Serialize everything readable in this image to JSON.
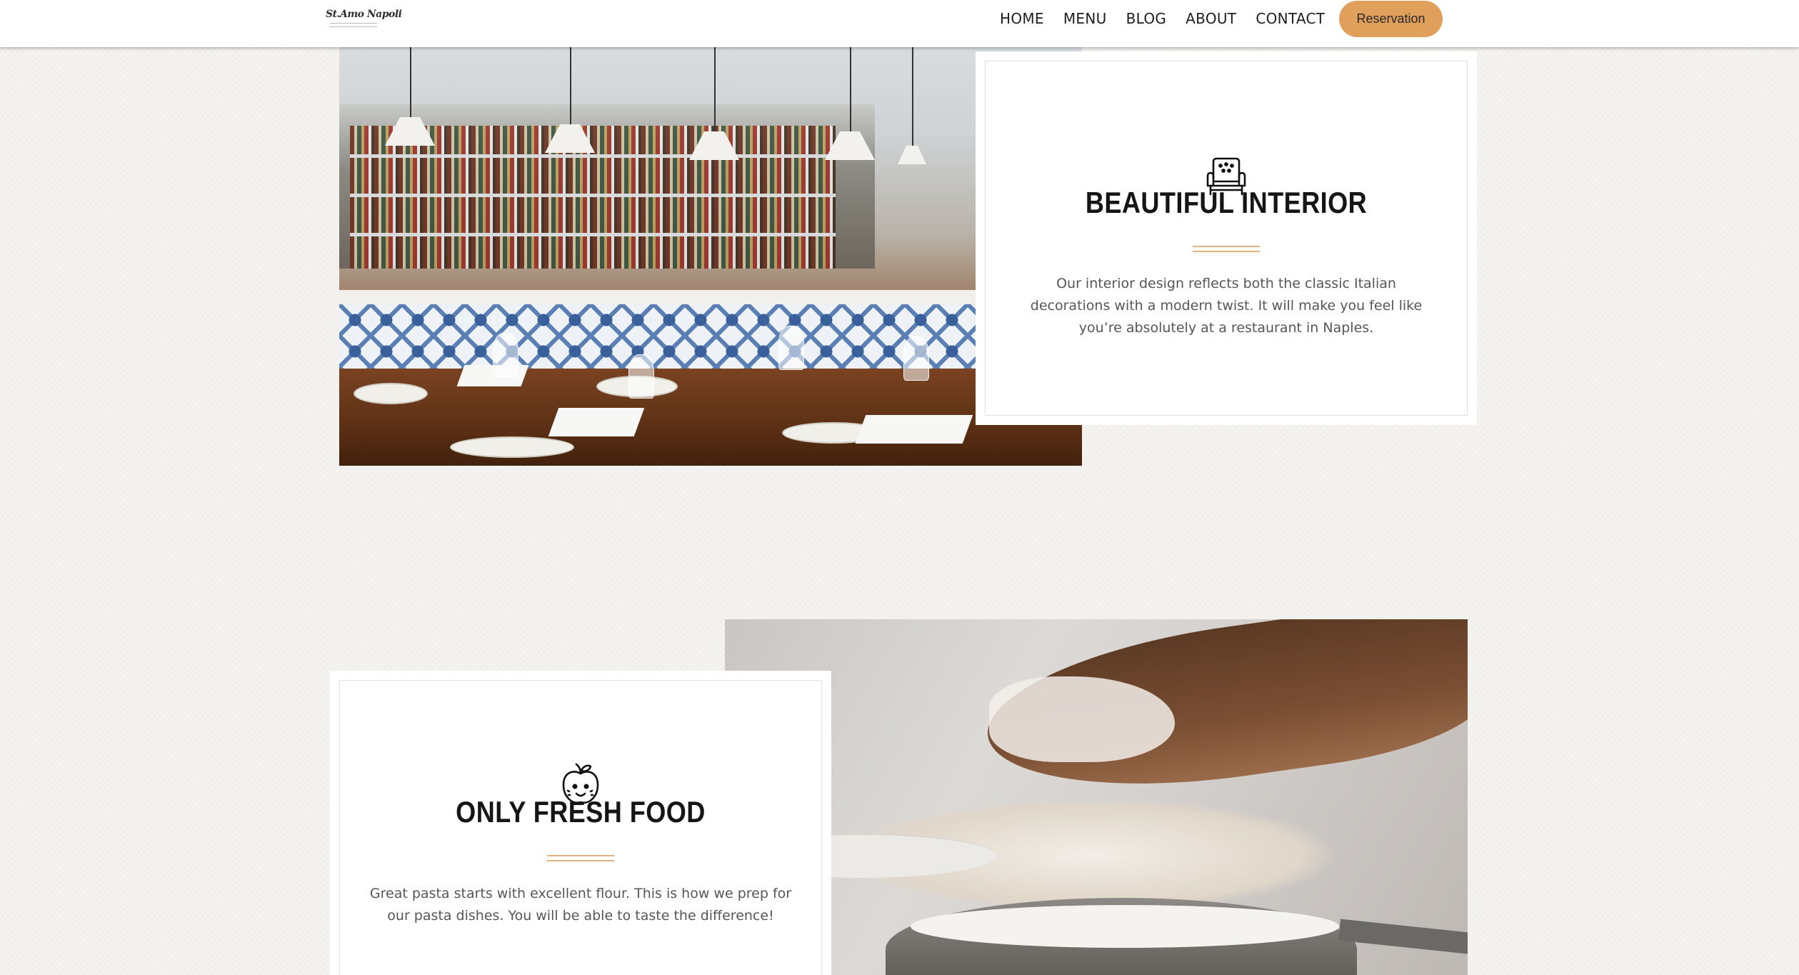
{
  "header": {
    "logo": {
      "script_text": "St.Amo Napoli",
      "tagline": "",
      "icon": "restaurant-logo"
    },
    "nav": [
      {
        "label": "HOME"
      },
      {
        "label": "MENU"
      },
      {
        "label": "BLOG"
      },
      {
        "label": "ABOUT"
      },
      {
        "label": "CONTACT"
      }
    ],
    "reservation_label": "Reservation"
  },
  "features": [
    {
      "icon": "armchair-icon",
      "title": "BEAUTIFUL INTERIOR",
      "text": "Our interior design reflects both the classic Italian decorations with a modern twist. It will make you feel like you’re absolutely at a restaurant in Naples.",
      "photo": "restaurant-bar-photo"
    },
    {
      "icon": "apple-icon",
      "title": "ONLY FRESH FOOD",
      "text": "Great pasta starts with excellent flour. This is how we prep for our pasta dishes. You will be able to taste the difference!",
      "photo": "flour-hand-photo"
    }
  ],
  "colors": {
    "accent": "#e0a05b",
    "rule": "#e2b27c",
    "title": "#151515",
    "body_text": "#565656",
    "background": "#f4f3f0"
  }
}
